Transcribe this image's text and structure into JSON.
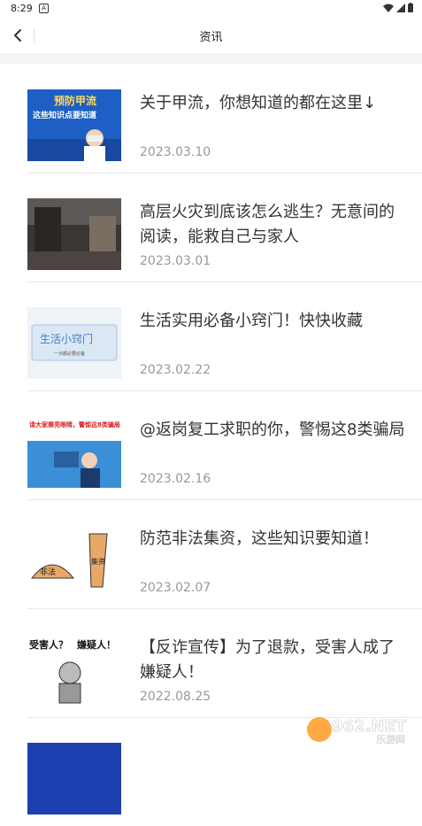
{
  "status": {
    "time": "8:29"
  },
  "header": {
    "title": "资讯"
  },
  "articles": [
    {
      "title": "关于甲流，你想知道的都在这里↓",
      "date": "2023.03.10",
      "thumb_text": "预防甲流",
      "thumb_sub": "这些知识点要知道"
    },
    {
      "title": "高层火灾到底该怎么逃生？无意间的阅读，能救自己与家人",
      "date": "2023.03.01"
    },
    {
      "title": "生活实用必备小窍门！快快收藏",
      "date": "2023.02.22",
      "thumb_text": "生活小窍门",
      "thumb_sub": "一点都必要必备"
    },
    {
      "title": "@返岗复工求职的你，警惕这8类骗局",
      "date": "2023.02.16",
      "thumb_text": "请大家擦亮眼睛，警惕这8类骗局！"
    },
    {
      "title": "防范非法集资，这些知识要知道！",
      "date": "2023.02.07",
      "thumb_text": "非法",
      "thumb_sub": "集资"
    },
    {
      "title": "【反诈宣传】为了退款，受害人成了嫌疑人！",
      "date": "2022.08.25",
      "thumb_text": "受害人？",
      "thumb_sub": "嫌疑人！"
    }
  ],
  "watermark": {
    "text": "962.NET",
    "sub": "乐游网"
  }
}
